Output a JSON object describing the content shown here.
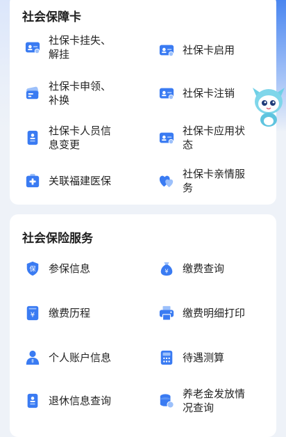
{
  "colors": {
    "accent": "#3a7bf2",
    "accent_light": "#9cc0fb",
    "page_bg": "#eef2f8",
    "card_bg": "#ffffff",
    "text": "#222222"
  },
  "social_card": {
    "title": "社会保障卡",
    "items": [
      {
        "label": "社保卡挂失、解挂",
        "icon": "id-card-icon"
      },
      {
        "label": "社保卡启用",
        "icon": "id-card-icon"
      },
      {
        "label": "社保卡申领、补换",
        "icon": "card-stack-icon"
      },
      {
        "label": "社保卡注销",
        "icon": "id-card-icon"
      },
      {
        "label": "社保卡人员信息变更",
        "icon": "document-person-icon"
      },
      {
        "label": "社保卡应用状态",
        "icon": "id-card-icon"
      },
      {
        "label": "关联福建医保",
        "icon": "medical-kit-icon"
      },
      {
        "label": "社保卡亲情服务",
        "icon": "hearts-icon"
      }
    ]
  },
  "insurance_service": {
    "title": "社会保险服务",
    "items": [
      {
        "label": "参保信息",
        "icon": "shield-icon",
        "glyph": "保"
      },
      {
        "label": "缴费查询",
        "icon": "money-bag-icon",
        "glyph": "¥"
      },
      {
        "label": "缴费历程",
        "icon": "receipt-icon",
        "glyph": "¥"
      },
      {
        "label": "缴费明细打印",
        "icon": "printer-icon"
      },
      {
        "label": "个人账户信息",
        "icon": "person-icon"
      },
      {
        "label": "待遇测算",
        "icon": "calculator-icon"
      },
      {
        "label": "退休信息查询",
        "icon": "document-person-icon"
      },
      {
        "label": "养老金发放情况查询",
        "icon": "coins-icon"
      }
    ]
  }
}
